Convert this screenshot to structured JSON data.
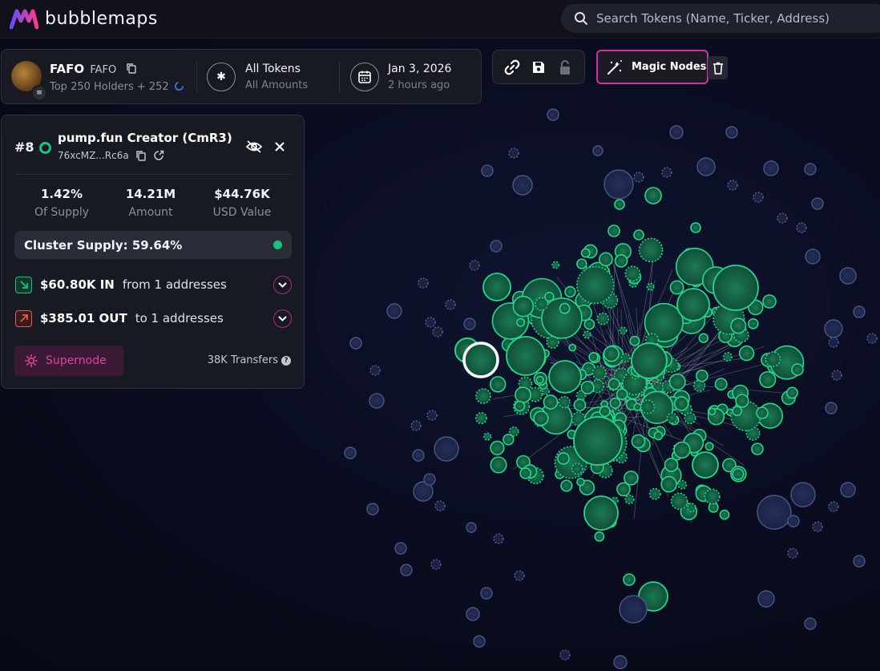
{
  "app": {
    "name": "bubblemaps"
  },
  "search": {
    "placeholder": "Search Tokens (Name, Ticker, Address)"
  },
  "token": {
    "name": "FAFO",
    "ticker": "FAFO",
    "holders_label": "Top 250 Holders + 252",
    "filter_title": "All Tokens",
    "filter_sub": "All Amounts",
    "date": "Jan 3, 2026",
    "date_sub": "2 hours ago"
  },
  "toolbar": {
    "magic_label": "Magic Nodes"
  },
  "holder": {
    "rank": "#8",
    "name": "pump.fun Creator (CmR3)",
    "address": "76xcMZ...Rc6a",
    "stats": [
      {
        "value": "1.42%",
        "label": "Of Supply"
      },
      {
        "value": "14.21M",
        "label": "Amount"
      },
      {
        "value": "$44.76K",
        "label": "USD Value"
      }
    ],
    "cluster_supply": "Cluster Supply: 59.64%",
    "flow_in_amount": "$60.80K IN",
    "flow_in_text": "from 1 addresses",
    "flow_out_amount": "$385.01 OUT",
    "flow_out_text": "to 1 addresses",
    "supernode_label": "Supernode",
    "transfers": "38K Transfers"
  },
  "colors": {
    "accent": "#d0319b",
    "green": "#12c67a",
    "blue_node": "#2a3563",
    "background": "#0a0d20"
  },
  "icons": [
    "search-icon",
    "copy-icon",
    "asterisk-icon",
    "calendar-icon",
    "link-icon",
    "save-icon",
    "lock-icon",
    "magic-wand-icon",
    "trash-icon",
    "hide-icon",
    "close-icon",
    "external-link-icon",
    "arrow-in-icon",
    "arrow-out-icon",
    "chevron-down-icon",
    "sun-icon",
    "help-icon"
  ]
}
